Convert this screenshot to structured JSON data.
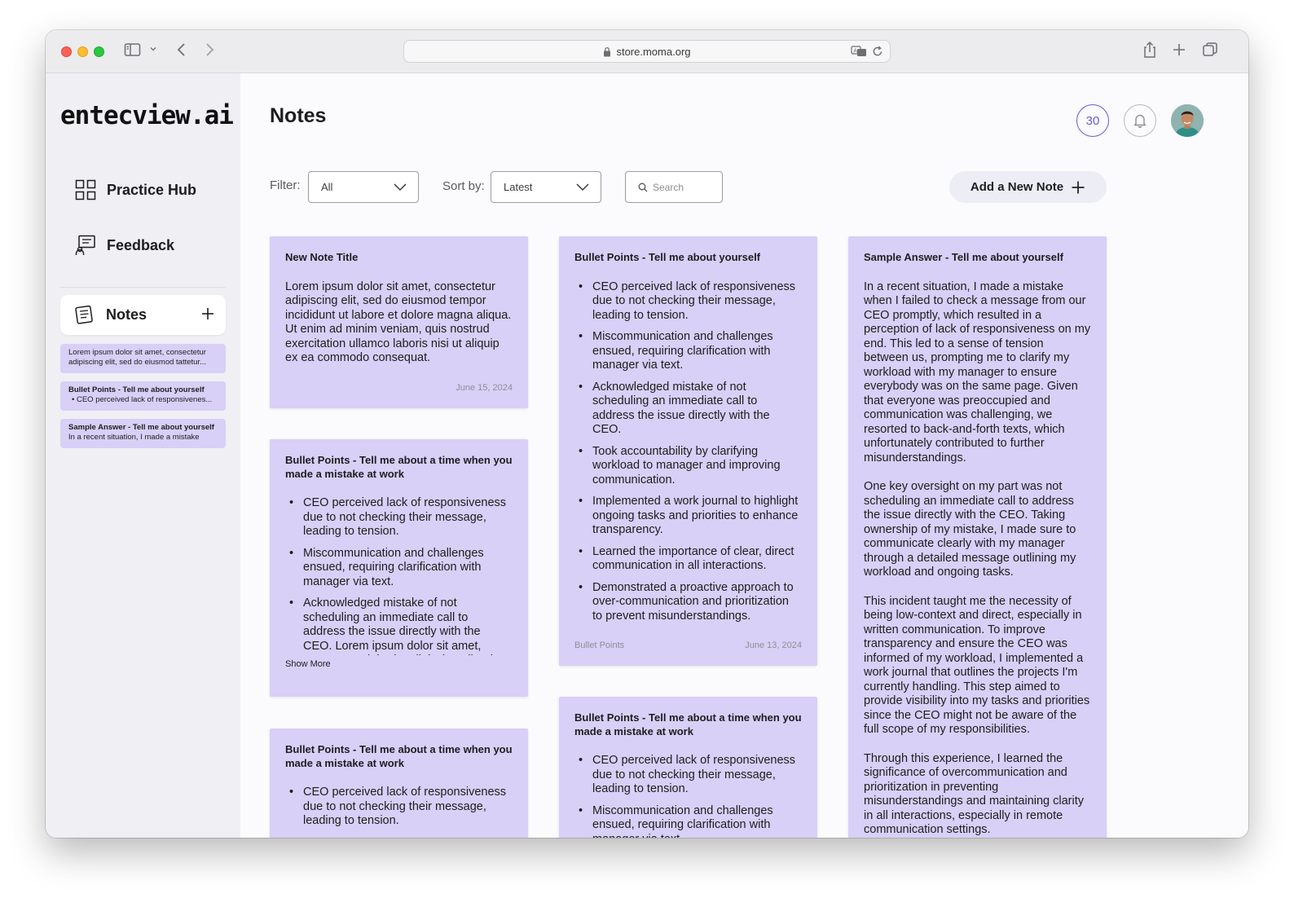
{
  "browser": {
    "url": "store.moma.org"
  },
  "sidebar": {
    "logo": "entecview.ai",
    "nav": [
      {
        "label": "Practice Hub",
        "icon": "grid-icon"
      },
      {
        "label": "Feedback",
        "icon": "feedback-icon"
      }
    ],
    "notes_tab": {
      "label": "Notes",
      "icon": "notes-icon"
    },
    "note_previews": [
      {
        "title": "",
        "text": "Lorem ipsum dolor sit amet, consectetur adipiscing elit, sed do eiusmod tattetur..."
      },
      {
        "title": "Bullet Points - Tell me about yourself",
        "text": "• CEO perceived lack of responsivenes..."
      },
      {
        "title": "Sample Answer - Tell me about yourself",
        "text": "In a recent situation, I made a mistake"
      }
    ]
  },
  "header": {
    "title": "Notes",
    "credits": "30"
  },
  "toolbar": {
    "filter_label": "Filter:",
    "filter_value": "All",
    "sort_label": "Sort by:",
    "sort_value": "Latest",
    "search_placeholder": "Search",
    "add_label": "Add a New Note"
  },
  "notes": [
    {
      "title": "New Note Title",
      "body": "Lorem ipsum dolor sit amet, consectetur adipiscing elit, sed do eiusmod tempor incididunt ut labore et dolore magna aliqua. Ut enim ad minim veniam, quis nostrud exercitation ullamco laboris nisi ut aliquip ex ea commodo consequat.",
      "date": "June 15, 2024"
    },
    {
      "title": "Bullet Points - Tell me about a time when you made a mistake at work",
      "bullets": [
        "CEO perceived lack of responsiveness due to not checking their message, leading to tension.",
        "Miscommunication and challenges ensued, requiring clarification with manager via text.",
        "Acknowledged mistake of not scheduling an immediate call to address the issue directly with the CEO. Lorem ipsum dolor sit amet, consectetur laboris adipiscing elit ad minim veniamad tyu"
      ],
      "show_more": "Show More"
    },
    {
      "title": "Bullet Points - Tell me about a time when you made a mistake at work",
      "bullets": [
        "CEO perceived lack of responsiveness due to not checking their message, leading to tension."
      ]
    },
    {
      "title": "Bullet Points - Tell me about yourself",
      "bullets": [
        "CEO perceived lack of responsiveness due to not checking their message, leading to tension.",
        "Miscommunication and challenges ensued, requiring clarification with manager via text.",
        "Acknowledged mistake of not scheduling an immediate call to address the issue directly with the CEO.",
        "Took accountability by clarifying workload to manager and improving communication.",
        "Implemented a work journal to highlight ongoing tasks and priorities to enhance transparency.",
        "Learned the importance of clear, direct communication in all interactions.",
        "Demonstrated a proactive approach to over-communication and prioritization to prevent misunderstandings."
      ],
      "tag": "Bullet Points",
      "date": "June 13, 2024"
    },
    {
      "title": "Bullet Points - Tell me about a time when you made a mistake at work",
      "bullets": [
        "CEO perceived lack of responsiveness due to not checking their message, leading to tension.",
        "Miscommunication and challenges ensued, requiring clarification with manager via text."
      ]
    },
    {
      "title": "Sample Answer - Tell me about yourself",
      "paragraphs": [
        "In a recent situation, I made a mistake when I failed to check a message from our CEO promptly, which resulted in a perception of lack of responsiveness on my end. This led to a sense of tension between us, prompting me to clarify my workload with my manager to ensure everybody was on the same page. Given that everyone was preoccupied and communication was challenging, we resorted to back-and-forth texts, which unfortunately contributed to further misunderstandings.",
        "One key oversight on my part was not scheduling an immediate call to address the issue directly with the CEO. Taking ownership of my mistake, I made sure to communicate clearly with my manager through a detailed message outlining my workload and ongoing tasks.",
        "This incident taught me the necessity of being low-context and direct, especially in written communication. To improve transparency and ensure the CEO was informed of my workload, I implemented a work journal that outlines the projects I'm currently handling. This step aimed to provide visibility into my tasks and priorities since the CEO might not be aware of the full scope of my responsibilities.",
        "Through this experience, I learned the significance of overcommunication and prioritization in preventing misunderstandings and maintaining clarity in all interactions, especially in remote communication settings."
      ]
    }
  ],
  "colors": {
    "note_bg": "#d8d0f7",
    "accent": "#6a5bd6",
    "sidebar_bg": "#efeff4"
  }
}
